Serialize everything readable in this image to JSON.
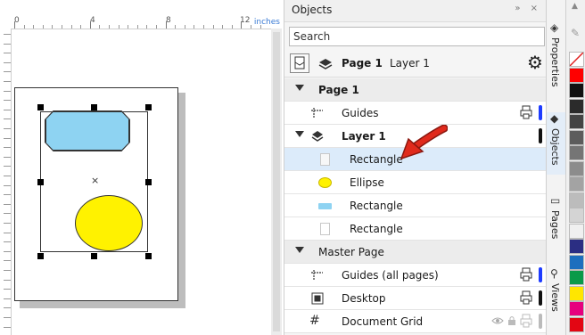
{
  "ruler": {
    "labels": [
      "0",
      "4",
      "8",
      "12"
    ],
    "unit": "inches"
  },
  "canvas": {
    "center_marker": "×"
  },
  "docker": {
    "title": "Objects",
    "title_buttons": "» ×",
    "search_placeholder": "Search",
    "toolbar": {
      "page": "Page 1",
      "layer": "Layer 1"
    },
    "tree": [
      {
        "label": "Page 1",
        "kind": "page-header"
      },
      {
        "label": "Guides",
        "kind": "layer",
        "bar_color": "#1e3cff"
      },
      {
        "label": "Layer 1",
        "kind": "layer-expanded",
        "bar_color": "#111111"
      },
      {
        "label": "Rectangle",
        "kind": "object",
        "selected": true
      },
      {
        "label": "Ellipse",
        "kind": "object"
      },
      {
        "label": "Rectangle",
        "kind": "object"
      },
      {
        "label": "Rectangle",
        "kind": "object"
      },
      {
        "label": "Master Page",
        "kind": "page-header"
      },
      {
        "label": "Guides (all pages)",
        "kind": "layer",
        "bar_color": "#1e3cff"
      },
      {
        "label": "Desktop",
        "kind": "layer",
        "bar_color": "#111111"
      },
      {
        "label": "Document Grid",
        "kind": "layer",
        "bar_color": "#bbbbbb"
      }
    ]
  },
  "side_tabs": [
    {
      "label": "Properties",
      "icon": "properties-icon"
    },
    {
      "label": "Objects",
      "icon": "layers-icon"
    },
    {
      "label": "Pages",
      "icon": "pages-icon"
    },
    {
      "label": "Views",
      "icon": "magnifier-icon"
    }
  ],
  "palette_colors": [
    "#ffffff",
    "#ff0000",
    "#111111",
    "#2b2b2b",
    "#444444",
    "#5c5c5c",
    "#757575",
    "#8c8c8c",
    "#a3a3a3",
    "#bcbcbc",
    "#d4d4d4",
    "#f0f0f0",
    "#2b2e83",
    "#1d6fbe",
    "#0a9a49",
    "#ffe600",
    "#e6007e",
    "#e30613"
  ],
  "colors": {
    "shape_fill_blue": "#8ed3f2",
    "shape_fill_yellow": "#fff200",
    "selection_row": "#dcebfa",
    "annotation_arrow": "#e02a1c"
  }
}
